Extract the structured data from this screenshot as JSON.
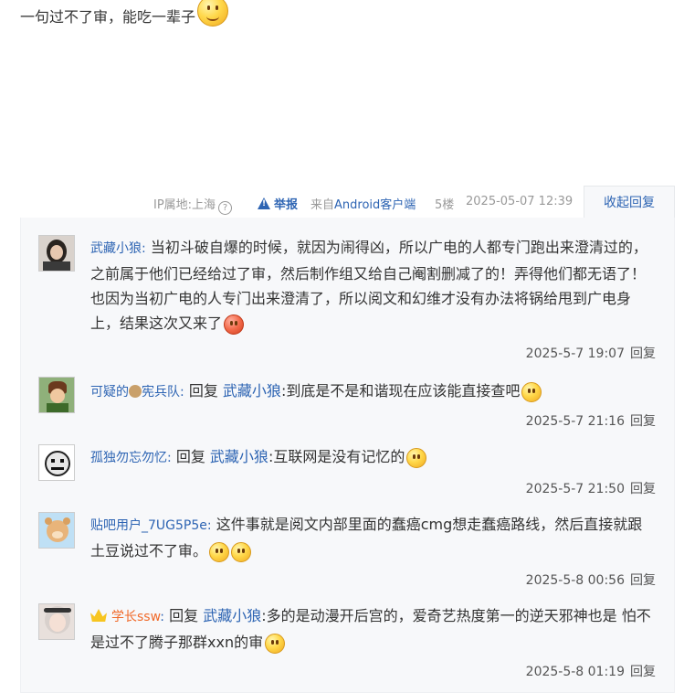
{
  "post": {
    "text": "一句过不了审，能吃一辈子",
    "emoji": "smile-emoji"
  },
  "meta": {
    "ip": "IP属地:上海",
    "help": "?",
    "report": "举报",
    "client_prefix": "来自",
    "client": "Android客户端",
    "floor": "5楼",
    "time": "2025-05-07 12:39",
    "collapse": "收起回复"
  },
  "replies": [
    {
      "user": "武藏小狼",
      "sep": ":",
      "text": "当初斗破自爆的时候，就因为闹得凶，所以广电的人都专门跑出来澄清过的，之前属于他们已经给过了审，然后制作组又给自己阉割删减了的！弄得他们都无语了！也因为当初广电的人专门出来澄清了，所以阅文和幻维才没有办法将锅给甩到广电身上，结果这次又来了",
      "time": "2025-5-7 19:07",
      "reply_btn": "回复"
    },
    {
      "user_prefix": "可疑的",
      "user_suffix": "宪兵队",
      "sep": ":",
      "reply_kw": "回复",
      "target": "武藏小狼",
      "text": ":到底是不是和谐现在应该能直接查吧",
      "time": "2025-5-7 21:16",
      "reply_btn": "回复"
    },
    {
      "user": "孤独勿忘勿忆",
      "sep": ":",
      "reply_kw": "回复",
      "target": "武藏小狼",
      "text": ":互联网是没有记忆的",
      "time": "2025-5-7 21:50",
      "reply_btn": "回复"
    },
    {
      "user": "贴吧用户_7UG5P5e",
      "sep": ":",
      "text": "这件事就是阅文内部里面的蠢癌cmg想走蠢癌路线，然后直接就跟土豆说过不了审。",
      "time": "2025-5-8 00:56",
      "reply_btn": "回复"
    },
    {
      "user": "学长ssw",
      "sep": ":",
      "reply_kw": "回复",
      "target": "武藏小狼",
      "text": ":多的是动漫开后宫的，爱奇艺热度第一的逆天邪神也是 怕不是过不了腾子那群xxn的审",
      "time": "2025-5-8 01:19",
      "reply_btn": "回复"
    }
  ],
  "colors": {
    "link": "#2d64b3",
    "vip": "#f06a2a",
    "panel": "#f7f8fa"
  }
}
